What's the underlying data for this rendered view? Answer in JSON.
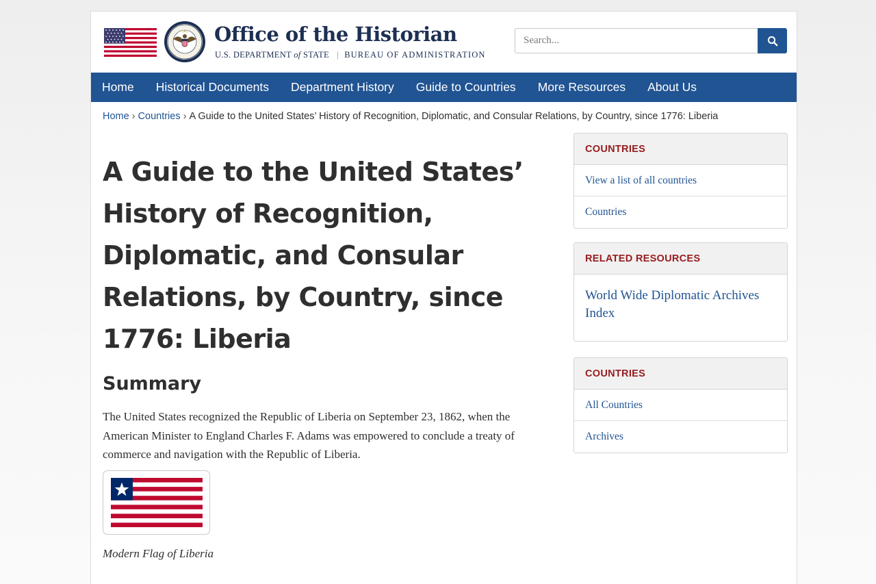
{
  "header": {
    "title": "Office of the Historian",
    "dept_part1": "U.S. DEPARTMENT",
    "dept_of": "of",
    "dept_part2": "STATE",
    "bureau": "BUREAU OF ADMINISTRATION"
  },
  "search": {
    "placeholder": "Search...",
    "value": ""
  },
  "nav": {
    "items": [
      {
        "label": "Home"
      },
      {
        "label": "Historical Documents"
      },
      {
        "label": "Department History"
      },
      {
        "label": "Guide to Countries"
      },
      {
        "label": "More Resources"
      },
      {
        "label": "About Us"
      }
    ]
  },
  "breadcrumb": {
    "home": "Home",
    "countries": "Countries",
    "current": "A Guide to the United States’ History of Recognition, Diplomatic, and Consular Relations, by Country, since 1776: Liberia"
  },
  "main": {
    "title": "A Guide to the United States’ History of Recognition, Diplomatic, and Consular Relations, by Country, since 1776: Liberia",
    "summary_heading": "Summary",
    "summary_text": "The United States recognized the Republic of Liberia on September 23, 1862, when the American Minister to England Charles F. Adams was empowered to conclude a treaty of commerce and navigation with the Republic of Liberia.",
    "flag_caption": "Modern Flag of Liberia"
  },
  "sidebar": {
    "panels": [
      {
        "heading": "COUNTRIES",
        "items": [
          "View a list of all countries",
          "Countries"
        ]
      },
      {
        "heading": "RELATED RESOURCES",
        "items": [
          "World Wide Diplomatic Archives Index"
        ]
      },
      {
        "heading": "COUNTRIES",
        "items": [
          "All Countries",
          "Archives"
        ]
      }
    ]
  },
  "colors": {
    "nav_blue": "#205493",
    "link_blue": "#205493",
    "panel_heading_red": "#981b1e",
    "title_navy": "#1d2f52",
    "flag_red": "#bf0a30",
    "flag_blue": "#002868"
  }
}
